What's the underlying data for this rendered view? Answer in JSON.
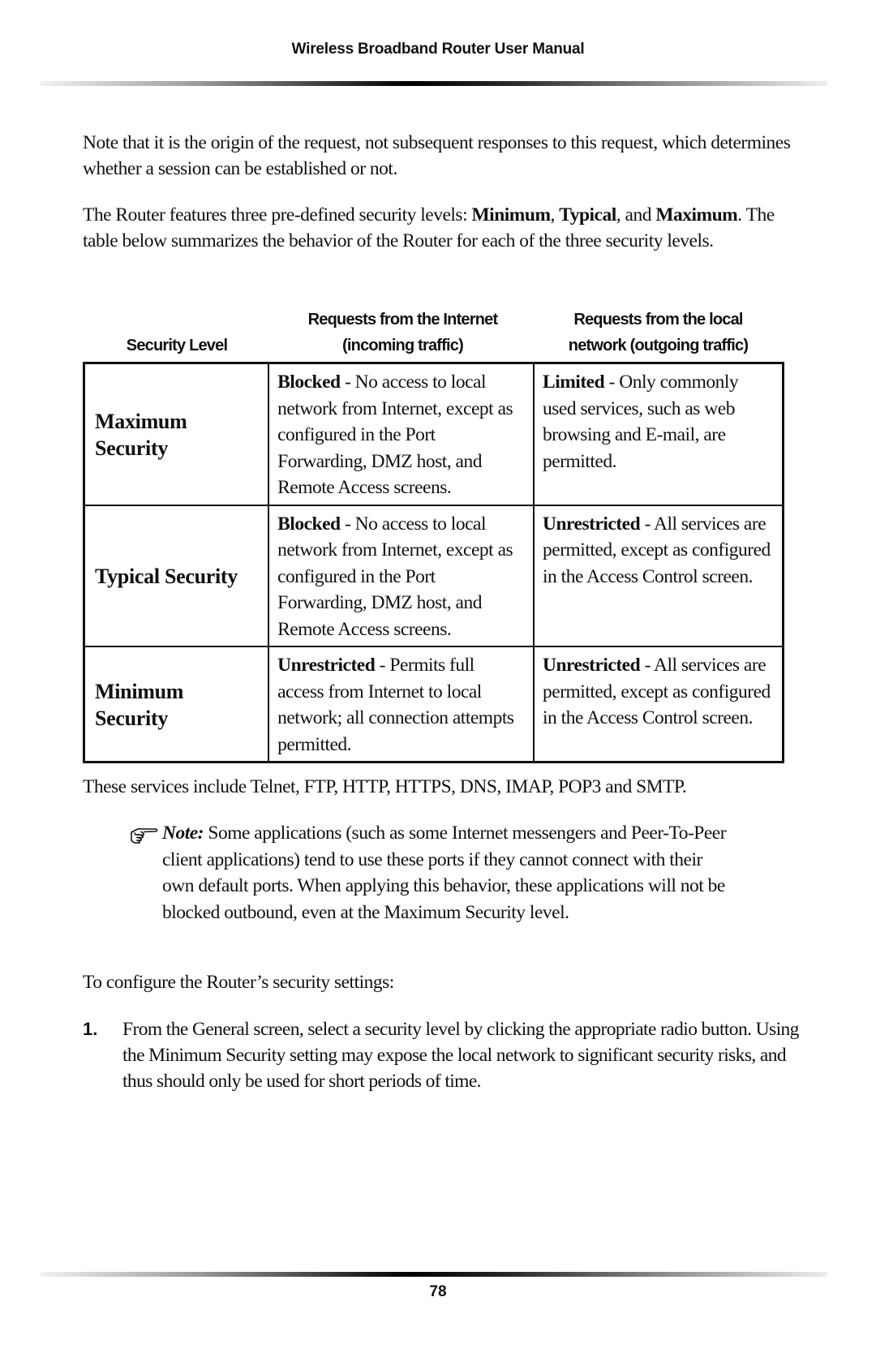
{
  "header": {
    "title": "Wireless Broadband Router User Manual"
  },
  "paragraphs": {
    "p1": "Note that it is the origin of the request, not subsequent responses to this request, which determines whether a session can be established or not.",
    "p2": {
      "part1": "The Router features three pre-defined security levels: ",
      "bold1": "Minimum",
      "sep1": ", ",
      "bold2": "Typical",
      "sep2": ", and ",
      "bold3": "Maximum",
      "part2": ". The table below summarizes the behavior of the Router for each of the three security levels."
    },
    "p3": "These services include Telnet, FTP, HTTP, HTTPS, DNS, IMAP, POP3 and SMTP.",
    "p4": "To configure the Router’s security settings:"
  },
  "table": {
    "headers": {
      "level": "Security Level",
      "incoming_line1": "Requests from the Internet",
      "incoming_line2": "(incoming traffic)",
      "outgoing_line1": "Requests from the local",
      "outgoing_line2": "network (outgoing traffic)"
    },
    "rows": [
      {
        "level": "Maximum Security",
        "incoming_status": "Blocked",
        "incoming_desc": " - No access to local network from Internet, except as configured in the Port Forwarding, DMZ host, and Remote Access screens.",
        "outgoing_status": "Limited",
        "outgoing_desc": " - Only commonly used services, such as web browsing and E-mail, are permitted."
      },
      {
        "level": "Typical Security",
        "incoming_status": "Blocked",
        "incoming_desc": " - No access to local network from Internet, except as configured in the Port Forwarding, DMZ host, and Remote Access screens.",
        "outgoing_status": "Unrestricted",
        "outgoing_desc": " - All services are permitted, except as configured in the Access Control screen."
      },
      {
        "level": "Minimum Security",
        "incoming_status": "Unrestricted",
        "incoming_desc": " - Permits full access from Internet to local network; all connection attempts permitted.",
        "outgoing_status": "Unrestricted",
        "outgoing_desc": " - All services are permitted, except as configured in the Access Control screen."
      }
    ]
  },
  "note": {
    "icon": "pointing-hand-icon",
    "label": "Note:",
    "text": " Some applications (such as some Internet messengers and Peer-To-Peer client applications) tend to use these ports if they cannot connect with their own default ports. When applying this behavior, these applications will not be blocked outbound, even at the Maximum Security level."
  },
  "steps": [
    {
      "number": "1.",
      "text": "From the General screen, select a security level by clicking the appropriate radio button. Using the Minimum Security setting may expose the local network to significant security risks, and thus should only be used for short periods of time."
    }
  ],
  "footer": {
    "page_number": "78"
  }
}
